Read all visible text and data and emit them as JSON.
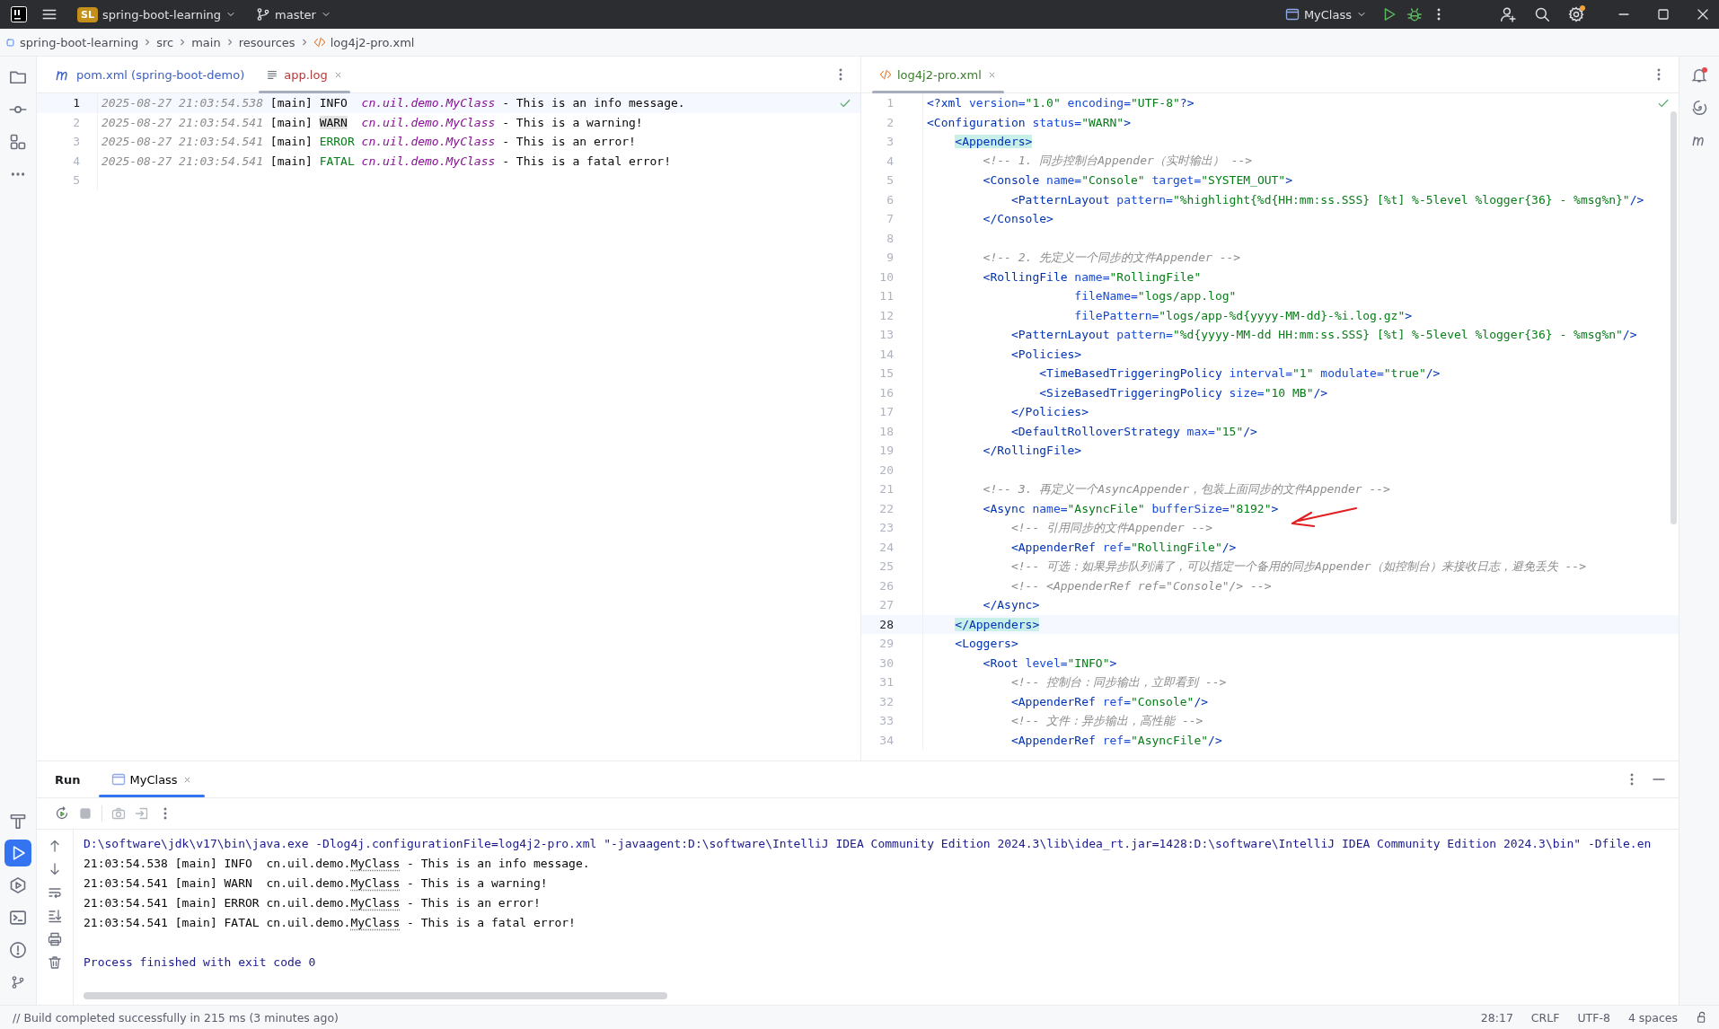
{
  "title_bar": {
    "project_badge": "SL",
    "project": "spring-boot-learning",
    "branch": "master",
    "run_config": "MyClass"
  },
  "breadcrumbs": [
    {
      "kind": "module",
      "label": "spring-boot-learning"
    },
    {
      "kind": "folder",
      "label": "src"
    },
    {
      "kind": "folder",
      "label": "main"
    },
    {
      "kind": "folder",
      "label": "resources"
    },
    {
      "kind": "xml",
      "label": "log4j2-pro.xml"
    }
  ],
  "left_toolbar": [
    {
      "kind": "project",
      "selected": false
    },
    {
      "kind": "commit",
      "selected": false
    },
    {
      "kind": "structure",
      "selected": false
    },
    {
      "kind": "more",
      "selected": false
    }
  ],
  "left_toolbar_bottom": [
    {
      "kind": "build",
      "selected": false
    },
    {
      "kind": "run",
      "selected": true
    },
    {
      "kind": "services",
      "selected": false
    },
    {
      "kind": "terminal",
      "selected": false
    },
    {
      "kind": "problems",
      "selected": false
    },
    {
      "kind": "git",
      "selected": false
    }
  ],
  "left_editor": {
    "tabs": [
      {
        "kind": "pom",
        "label": "pom.xml (spring-boot-demo)",
        "selected": false,
        "color": "#3d5fc2"
      },
      {
        "kind": "log",
        "label": "app.log",
        "selected": true,
        "color": "#b23b3b"
      }
    ],
    "lines": [
      {
        "number": "1",
        "current": true,
        "tokens": [
          {
            "kind": "timestamp",
            "text": "2025-08-27 21:03:54.538"
          },
          {
            "kind": "plain",
            "text": " [main] INFO  "
          },
          {
            "kind": "class_name",
            "text": "cn.uil.demo.MyClass"
          },
          {
            "kind": "plain",
            "text": " - This is an info message."
          }
        ]
      },
      {
        "number": "2",
        "current": false,
        "tokens": [
          {
            "kind": "timestamp",
            "text": "2025-08-27 21:03:54.541"
          },
          {
            "kind": "plain",
            "text": " [main] "
          },
          {
            "kind": "warn_level",
            "text": "WARN"
          },
          {
            "kind": "class_name",
            "text": "  cn.uil.demo.MyClass"
          },
          {
            "kind": "plain",
            "text": " - This is a warning!"
          }
        ]
      },
      {
        "number": "3",
        "current": false,
        "tokens": [
          {
            "kind": "timestamp",
            "text": "2025-08-27 21:03:54.541"
          },
          {
            "kind": "plain",
            "text": " [main] "
          },
          {
            "kind": "error_level",
            "text": "ERROR"
          },
          {
            "kind": "class_name",
            "text": " cn.uil.demo.MyClass"
          },
          {
            "kind": "plain",
            "text": " - This is an error!"
          }
        ]
      },
      {
        "number": "4",
        "current": false,
        "tokens": [
          {
            "kind": "timestamp",
            "text": "2025-08-27 21:03:54.541"
          },
          {
            "kind": "plain",
            "text": " [main] "
          },
          {
            "kind": "error_level",
            "text": "FATAL"
          },
          {
            "kind": "class_name",
            "text": " cn.uil.demo.MyClass"
          },
          {
            "kind": "plain",
            "text": " - This is a fatal error!"
          }
        ]
      },
      {
        "number": "5",
        "current": false
      }
    ]
  },
  "right_editor": {
    "tabs": [
      {
        "kind": "xml",
        "label": "log4j2-pro.xml",
        "selected": true,
        "color": "#3b7d2c"
      }
    ],
    "lines": [
      {
        "number": "1",
        "current": false,
        "tokens": [
          {
            "kind": "tag",
            "text": "<?xml"
          },
          {
            "kind": "attribute",
            "text": " version="
          },
          {
            "kind": "value",
            "text": "\"1.0\""
          },
          {
            "kind": "attribute",
            "text": " encoding="
          },
          {
            "kind": "value",
            "text": "\"UTF-8\""
          },
          {
            "kind": "tag",
            "text": "?>"
          }
        ]
      },
      {
        "number": "2",
        "current": false,
        "tokens": [
          {
            "kind": "tag",
            "text": "<Configuration"
          },
          {
            "kind": "attribute",
            "text": " status="
          },
          {
            "kind": "value",
            "text": "\"WARN\""
          },
          {
            "kind": "tag",
            "text": ">"
          }
        ]
      },
      {
        "number": "3",
        "current": false,
        "tokens": [
          {
            "kind": "matched_tag",
            "text": "    <Appenders>"
          }
        ]
      },
      {
        "number": "4",
        "current": false,
        "tokens": [
          {
            "kind": "comment",
            "text": "        <!-- 1. 同步控制台Appender（实时输出） -->"
          }
        ]
      },
      {
        "number": "5",
        "current": false,
        "tokens": [
          {
            "kind": "tag",
            "text": "        <Console"
          },
          {
            "kind": "attribute",
            "text": " name="
          },
          {
            "kind": "value",
            "text": "\"Console\""
          },
          {
            "kind": "attribute",
            "text": " target="
          },
          {
            "kind": "value",
            "text": "\"SYSTEM_OUT\""
          },
          {
            "kind": "tag",
            "text": ">"
          }
        ]
      },
      {
        "number": "6",
        "current": false,
        "tokens": [
          {
            "kind": "tag",
            "text": "            <PatternLayout"
          },
          {
            "kind": "attribute",
            "text": " pattern="
          },
          {
            "kind": "value",
            "text": "\"%highlight{%d{HH:mm:ss.SSS} [%t] %-5level %logger{36} - %msg%n}\""
          },
          {
            "kind": "tag",
            "text": "/>"
          }
        ]
      },
      {
        "number": "7",
        "current": false,
        "tokens": [
          {
            "kind": "tag",
            "text": "        </Console>"
          }
        ]
      },
      {
        "number": "8",
        "current": false
      },
      {
        "number": "9",
        "current": false,
        "tokens": [
          {
            "kind": "comment",
            "text": "        <!-- 2. 先定义一个同步的文件Appender -->"
          }
        ]
      },
      {
        "number": "10",
        "current": false,
        "tokens": [
          {
            "kind": "tag",
            "text": "        <RollingFile"
          },
          {
            "kind": "attribute",
            "text": " name="
          },
          {
            "kind": "value",
            "text": "\"RollingFile\""
          }
        ]
      },
      {
        "number": "11",
        "current": false,
        "tokens": [
          {
            "kind": "attribute",
            "text": "                     fileName="
          },
          {
            "kind": "value",
            "text": "\"logs/app.log\""
          }
        ]
      },
      {
        "number": "12",
        "current": false,
        "tokens": [
          {
            "kind": "attribute",
            "text": "                     filePattern="
          },
          {
            "kind": "value",
            "text": "\"logs/app-%d{yyyy-MM-dd}-%i.log.gz\""
          },
          {
            "kind": "tag",
            "text": ">"
          }
        ]
      },
      {
        "number": "13",
        "current": false,
        "tokens": [
          {
            "kind": "tag",
            "text": "            <PatternLayout"
          },
          {
            "kind": "attribute",
            "text": " pattern="
          },
          {
            "kind": "value",
            "text": "\"%d{yyyy-MM-dd HH:mm:ss.SSS} [%t] %-5level %logger{36} - %msg%n\""
          },
          {
            "kind": "tag",
            "text": "/>"
          }
        ]
      },
      {
        "number": "14",
        "current": false,
        "tokens": [
          {
            "kind": "tag",
            "text": "            <Policies>"
          }
        ]
      },
      {
        "number": "15",
        "current": false,
        "tokens": [
          {
            "kind": "tag",
            "text": "                <TimeBasedTriggeringPolicy"
          },
          {
            "kind": "attribute",
            "text": " interval="
          },
          {
            "kind": "value",
            "text": "\"1\""
          },
          {
            "kind": "attribute",
            "text": " modulate="
          },
          {
            "kind": "value",
            "text": "\"true\""
          },
          {
            "kind": "tag",
            "text": "/>"
          }
        ]
      },
      {
        "number": "16",
        "current": false,
        "tokens": [
          {
            "kind": "tag",
            "text": "                <SizeBasedTriggeringPolicy"
          },
          {
            "kind": "attribute",
            "text": " size="
          },
          {
            "kind": "value",
            "text": "\"10 MB\""
          },
          {
            "kind": "tag",
            "text": "/>"
          }
        ]
      },
      {
        "number": "17",
        "current": false,
        "tokens": [
          {
            "kind": "tag",
            "text": "            </Policies>"
          }
        ]
      },
      {
        "number": "18",
        "current": false,
        "tokens": [
          {
            "kind": "tag",
            "text": "            <DefaultRolloverStrategy"
          },
          {
            "kind": "attribute",
            "text": " max="
          },
          {
            "kind": "value",
            "text": "\"15\""
          },
          {
            "kind": "tag",
            "text": "/>"
          }
        ]
      },
      {
        "number": "19",
        "current": false,
        "tokens": [
          {
            "kind": "tag",
            "text": "        </RollingFile>"
          }
        ]
      },
      {
        "number": "20",
        "current": false
      },
      {
        "number": "21",
        "current": false,
        "tokens": [
          {
            "kind": "comment",
            "text": "        <!-- 3. 再定义一个AsyncAppender，包装上面同步的文件Appender -->"
          }
        ]
      },
      {
        "number": "22",
        "current": false,
        "tokens": [
          {
            "kind": "tag",
            "text": "        <Async"
          },
          {
            "kind": "attribute",
            "text": " name="
          },
          {
            "kind": "value",
            "text": "\"AsyncFile\""
          },
          {
            "kind": "attribute",
            "text": " bufferSize="
          },
          {
            "kind": "value",
            "text": "\"8192\""
          },
          {
            "kind": "tag",
            "text": ">"
          }
        ]
      },
      {
        "number": "23",
        "current": false,
        "tokens": [
          {
            "kind": "comment",
            "text": "            <!-- 引用同步的文件Appender -->"
          }
        ]
      },
      {
        "number": "24",
        "current": false,
        "tokens": [
          {
            "kind": "tag",
            "text": "            <AppenderRef"
          },
          {
            "kind": "attribute",
            "text": " ref="
          },
          {
            "kind": "value",
            "text": "\"RollingFile\""
          },
          {
            "kind": "tag",
            "text": "/>"
          }
        ]
      },
      {
        "number": "25",
        "current": false,
        "tokens": [
          {
            "kind": "comment",
            "text": "            <!-- 可选：如果异步队列满了，可以指定一个备用的同步Appender（如控制台）来接收日志，避免丢失 -->"
          }
        ]
      },
      {
        "number": "26",
        "current": false,
        "tokens": [
          {
            "kind": "comment",
            "text": "            <!-- <AppenderRef ref=\"Console\"/> -->"
          }
        ]
      },
      {
        "number": "27",
        "current": false,
        "tokens": [
          {
            "kind": "tag",
            "text": "        </Async>"
          }
        ]
      },
      {
        "number": "28",
        "current": true,
        "tokens": [
          {
            "kind": "matched_tag",
            "text": "    </Appenders>"
          }
        ]
      },
      {
        "number": "29",
        "current": false,
        "tokens": [
          {
            "kind": "tag",
            "text": "    <Loggers>"
          }
        ]
      },
      {
        "number": "30",
        "current": false,
        "tokens": [
          {
            "kind": "tag",
            "text": "        <Root"
          },
          {
            "kind": "attribute",
            "text": " level="
          },
          {
            "kind": "value",
            "text": "\"INFO\""
          },
          {
            "kind": "tag",
            "text": ">"
          }
        ]
      },
      {
        "number": "31",
        "current": false,
        "tokens": [
          {
            "kind": "comment",
            "text": "            <!-- 控制台：同步输出，立即看到 -->"
          }
        ]
      },
      {
        "number": "32",
        "current": false,
        "tokens": [
          {
            "kind": "tag",
            "text": "            <AppenderRef"
          },
          {
            "kind": "attribute",
            "text": " ref="
          },
          {
            "kind": "value",
            "text": "\"Console\""
          },
          {
            "kind": "tag",
            "text": "/>"
          }
        ]
      },
      {
        "number": "33",
        "current": false,
        "tokens": [
          {
            "kind": "comment",
            "text": "            <!-- 文件：异步输出，高性能 -->"
          }
        ]
      },
      {
        "number": "34",
        "current": false,
        "tokens": [
          {
            "kind": "tag",
            "text": "            <AppenderRef"
          },
          {
            "kind": "attribute",
            "text": " ref="
          },
          {
            "kind": "value",
            "text": "\"AsyncFile\""
          },
          {
            "kind": "tag",
            "text": "/>"
          }
        ]
      }
    ]
  },
  "run_panel": {
    "title": "Run",
    "tabs": [
      {
        "label": "MyClass",
        "selected": true
      }
    ],
    "console": [
      {
        "kind": "command",
        "text": "D:\\software\\jdk\\v17\\bin\\java.exe -Dlog4j.configurationFile=log4j2-pro.xml \"-javaagent:D:\\software\\IntelliJ IDEA Community Edition 2024.3\\lib\\idea_rt.jar=1428:D:\\software\\IntelliJ IDEA Community Edition 2024.3\\bin\" -Dfile.en"
      },
      {
        "kind": "log",
        "text": "21:03:54.538 [main] INFO  cn.uil.demo.",
        "link": "MyClass",
        "after": " - This is an info message."
      },
      {
        "kind": "log",
        "text": "21:03:54.541 [main] WARN  cn.uil.demo.",
        "link": "MyClass",
        "after": " - This is a warning!"
      },
      {
        "kind": "log",
        "text": "21:03:54.541 [main] ERROR cn.uil.demo.",
        "link": "MyClass",
        "after": " - This is an error!"
      },
      {
        "kind": "log",
        "text": "21:03:54.541 [main] FATAL cn.uil.demo.",
        "link": "MyClass",
        "after": " - This is a fatal error!"
      },
      {
        "kind": "blank"
      },
      {
        "kind": "exit",
        "text": "Process finished with exit code 0"
      }
    ]
  },
  "status_bar": {
    "message": "// Build completed successfully in 215 ms (3 minutes ago)",
    "position": "28:17",
    "line_ending": "CRLF",
    "encoding": "UTF-8",
    "indent": "4 spaces"
  }
}
